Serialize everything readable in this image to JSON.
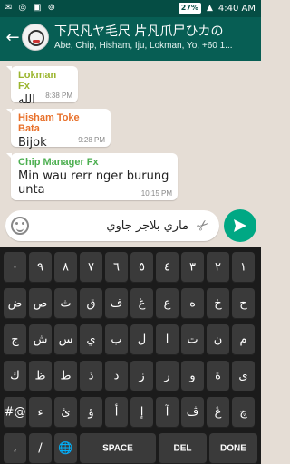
{
  "statusbar": {
    "battery": "27%",
    "time": "4:40",
    "time_suffix": "AM"
  },
  "header": {
    "title": "下尺凡ヤ毛尺 片凡爪尸ひカの",
    "subtitle": "Abe, Chip, Hisham, Iju, Lokman, Yo, +60 1..."
  },
  "messages": [
    {
      "sender": "Lokman Fx",
      "sender_color": "#9bb52e",
      "text": "الله",
      "time": "8:38 PM"
    },
    {
      "sender": "Hisham Toke Bata",
      "sender_color": "#e8702a",
      "text": "Bijok",
      "time": "9:28 PM"
    },
    {
      "sender": "Chip Manager Fx",
      "sender_color": "#4caf50",
      "text": "Min wau rerr nger burung unta",
      "time": "10:15 PM"
    }
  ],
  "composer": {
    "value": "ماري بلاجر جاوي"
  },
  "keyboard": {
    "rows": [
      [
        "٠",
        "٩",
        "٨",
        "٧",
        "٦",
        "٥",
        "٤",
        "٣",
        "٢",
        "١"
      ],
      [
        "ض",
        "ص",
        "ث",
        "ق",
        "ف",
        "غ",
        "ع",
        "ه",
        "خ",
        "ح"
      ],
      [
        "ج",
        "ش",
        "س",
        "ي",
        "ب",
        "ل",
        "ا",
        "ت",
        "ن",
        "م"
      ],
      [
        "ك",
        "ظ",
        "ط",
        "ذ",
        "د",
        "ز",
        "ر",
        "و",
        "ة",
        "ى"
      ],
      [
        "#@",
        "ء",
        "ئ",
        "ؤ",
        "أ",
        "إ",
        "آ",
        "ڤ",
        "ڠ",
        "چ"
      ]
    ],
    "bottom": {
      "k1": "،",
      "k2": "/",
      "globe": "🌐",
      "space": "SPACE",
      "del": "DEL",
      "done": "DONE"
    }
  }
}
